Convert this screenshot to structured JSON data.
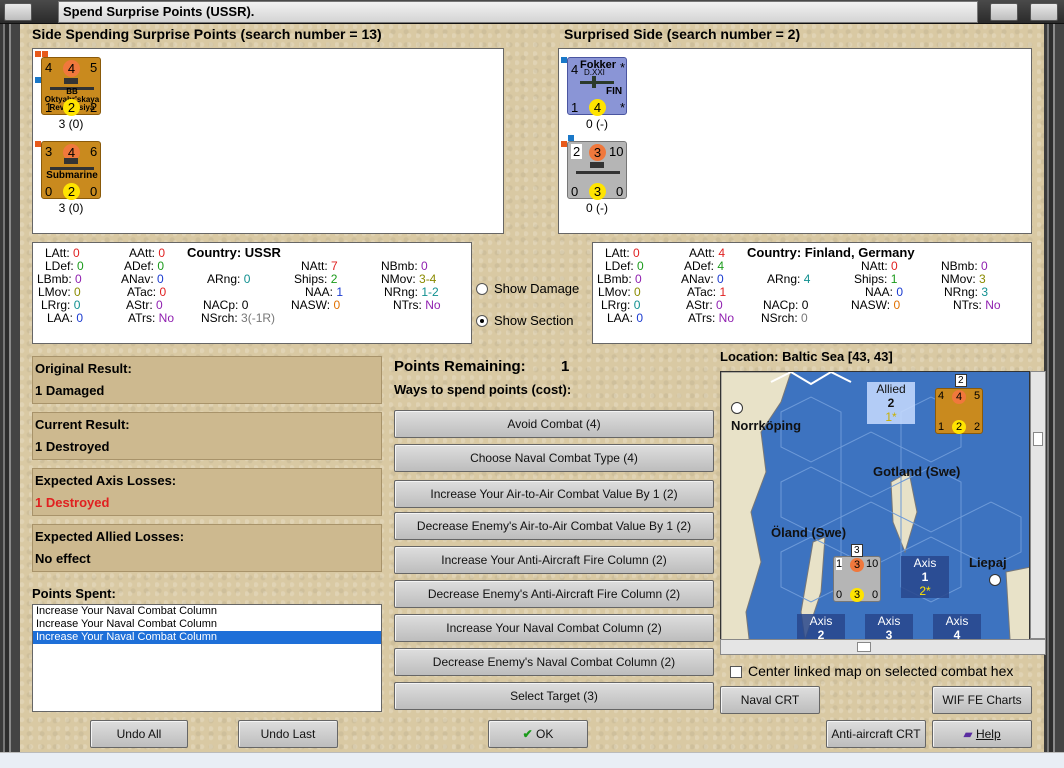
{
  "window": {
    "title": "Spend Surprise Points (USSR)."
  },
  "left_side": {
    "heading": "Side Spending Surprise Points (search number = 13)",
    "units": [
      {
        "top": [
          "4",
          "4",
          "5"
        ],
        "name": "BB Oktyabr'skaya Revolutsiya",
        "bottom": [
          "1",
          "2",
          "2"
        ],
        "sub": "3 (0)"
      },
      {
        "top": [
          "3",
          "4",
          "6"
        ],
        "name": "Submarine",
        "bottom": [
          "0",
          "2",
          "0"
        ],
        "sub": "3 (0)"
      }
    ]
  },
  "right_side": {
    "heading": "Surprised Side (search number = 2)",
    "units": [
      {
        "top": [
          "4",
          "Fokker",
          "*"
        ],
        "name": "FIN",
        "code": "D.XXI",
        "bottom": [
          "1",
          "4",
          "*"
        ],
        "sub": "0 (-)"
      },
      {
        "top": [
          "2",
          "3",
          "10"
        ],
        "bottom": [
          "0",
          "3",
          "0"
        ],
        "sub": "0 (-)"
      }
    ]
  },
  "stats_left": {
    "country_label": "Country: USSR",
    "LAtt": "0",
    "AAtt": "0",
    "LDef": "0",
    "ADef": "0",
    "LBmb": "0",
    "ANav": "0",
    "ARng": "0",
    "LMov": "0",
    "ATac": "0",
    "LRrg": "0",
    "AStr": "0",
    "NACp": "0",
    "LAA": "0",
    "ATrs": "No",
    "NSrch": "3",
    "NSrch_extra": "(-1R)",
    "NAtt": "7",
    "NBmb": "0",
    "Ships": "2",
    "NMov": "3-4",
    "NAA": "1",
    "NRng": "1-2",
    "NASW": "0",
    "NTrs": "No"
  },
  "stats_right": {
    "country_label": "Country: Finland, Germany",
    "LAtt": "0",
    "AAtt": "4",
    "LDef": "0",
    "ADef": "4",
    "LBmb": "0",
    "ANav": "0",
    "ARng": "4",
    "LMov": "0",
    "ATac": "1",
    "LRrg": "0",
    "AStr": "0",
    "NACp": "0",
    "LAA": "0",
    "ATrs": "No",
    "NSrch": "0",
    "NAtt": "0",
    "NBmb": "0",
    "Ships": "1",
    "NMov": "3",
    "NAA": "0",
    "NRng": "3",
    "NASW": "0",
    "NTrs": "No"
  },
  "options": {
    "show_damage": "Show Damage",
    "show_section": "Show Section",
    "selected": "show_section"
  },
  "results": {
    "original_title": "Original Result:",
    "original_value": "1 Damaged",
    "current_title": "Current Result:",
    "current_value": "1 Destroyed",
    "axis_title": "Expected Axis Losses:",
    "axis_value": "1 Destroyed",
    "allied_title": "Expected Allied Losses:",
    "allied_value": "No effect"
  },
  "points": {
    "spent_title": "Points Spent:",
    "spent_items": [
      "Increase Your Naval Combat Column",
      "Increase Your Naval Combat Column",
      "Increase Your Naval Combat Column"
    ],
    "remaining_label": "Points Remaining:",
    "remaining_value": "1",
    "ways_label": "Ways to spend points (cost):"
  },
  "spend_options": [
    "Avoid Combat (4)",
    "Choose Naval Combat Type (4)",
    "Increase Your Air-to-Air Combat Value By 1 (2)",
    "Decrease Enemy's Air-to-Air Combat Value By 1 (2)",
    "Increase Your Anti-Aircraft Fire Column (2)",
    "Decrease Enemy's Anti-Aircraft Fire Column (2)",
    "Increase Your Naval Combat Column (2)",
    "Decrease Enemy's Naval Combat Column (2)",
    "Select Target (3)"
  ],
  "map": {
    "location": "Location: Baltic Sea [43, 43]",
    "labels": {
      "norrkoping": "Norrköping",
      "gotland": "Gotland (Swe)",
      "oland": "Öland (Swe)",
      "liepaja": "Liepaj"
    },
    "allied_box": {
      "title": "Allied",
      "value": "2",
      "sub": "1*"
    },
    "axis_boxes": [
      {
        "title": "Axis",
        "value": "1",
        "sub": "2*"
      },
      {
        "title": "Axis",
        "value": "2"
      },
      {
        "title": "Axis",
        "value": "3"
      },
      {
        "title": "Axis",
        "value": "4"
      }
    ],
    "map_unit_top": [
      "4",
      "4",
      "5"
    ],
    "map_unit_bottom": [
      "1",
      "2",
      "2"
    ],
    "map_unit_badge": "2",
    "map_ship_top": [
      "1",
      "3",
      "10"
    ],
    "map_ship_bottom": [
      "0",
      "3",
      "0"
    ],
    "map_ship_badge": "3",
    "center_linked": "Center linked map on selected combat hex"
  },
  "buttons": {
    "naval_crt": "Naval CRT",
    "wif_fe": "WIF FE Charts",
    "undo_all": "Undo All",
    "undo_last": "Undo Last",
    "ok": "OK",
    "aa_crt": "Anti-aircraft CRT",
    "help": "Help"
  },
  "colors": {
    "sea": "#3d73c0",
    "land": "#e8e2c8",
    "selected_row": "#1e6fd8",
    "destroyed": "#e02020"
  }
}
